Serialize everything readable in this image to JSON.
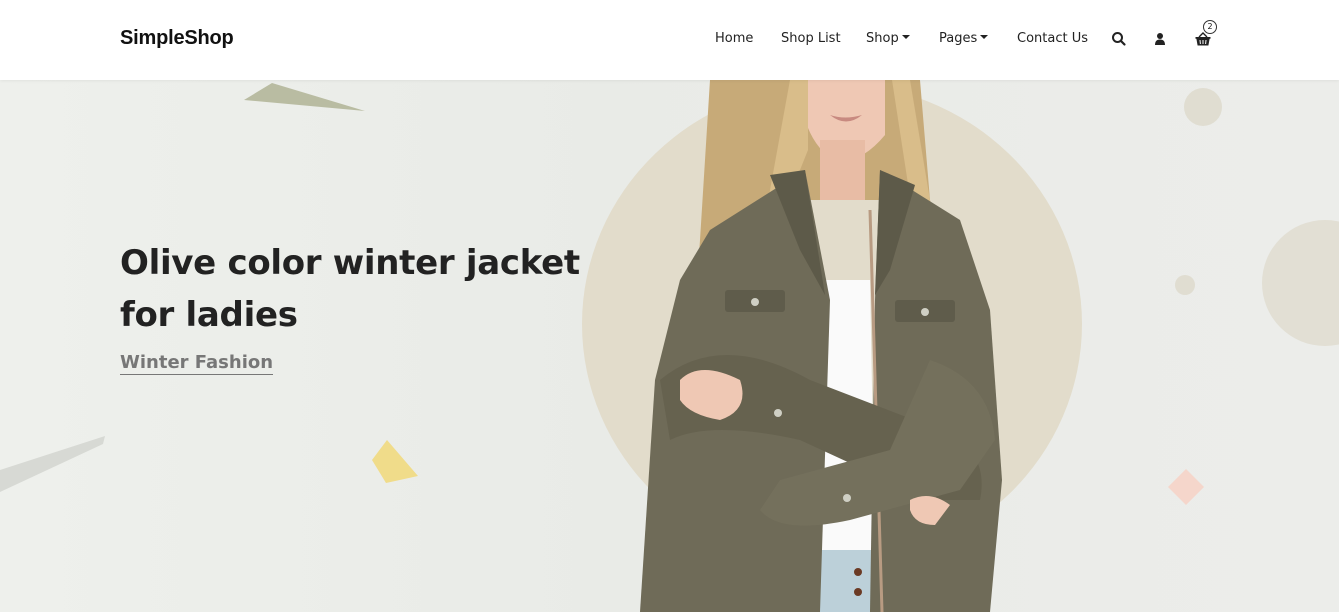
{
  "brand": {
    "name": "SimpleShop"
  },
  "nav": {
    "items": [
      {
        "label": "Home",
        "dropdown": false
      },
      {
        "label": "Shop List",
        "dropdown": false
      },
      {
        "label": "Shop",
        "dropdown": true
      },
      {
        "label": "Pages",
        "dropdown": true
      },
      {
        "label": "Contact Us",
        "dropdown": false
      }
    ],
    "icons": [
      "search-icon",
      "user-icon",
      "basket-icon"
    ],
    "cart_count": "2"
  },
  "hero": {
    "title": "Olive color winter jacket for ladies",
    "subtitle": "Winter Fashion",
    "image_subject": "woman in olive jacket",
    "colors": {
      "circle": "#e2dccb",
      "jacket": "#6f6b58",
      "accent_yellow": "#f0dc8a",
      "accent_pink": "#f5d6cb",
      "accent_olive": "#b9bca2"
    }
  }
}
